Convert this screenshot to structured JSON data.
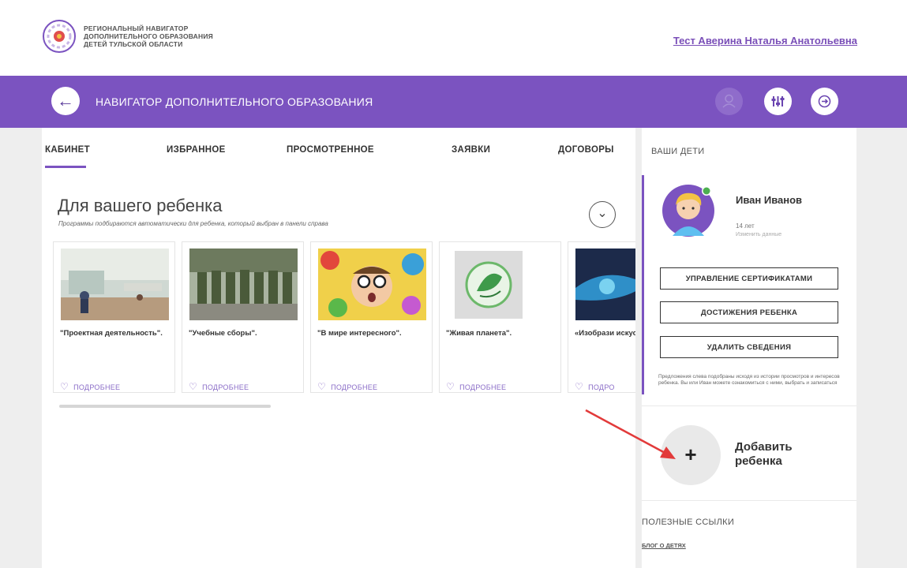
{
  "header": {
    "org_lines": [
      "РЕГИОНАЛЬНЫЙ НАВИГАТОР",
      "ДОПОЛНИТЕЛЬНОГО ОБРАЗОВАНИЯ",
      "ДЕТЕЙ ТУЛЬСКОЙ ОБЛАСТИ"
    ],
    "user_name": "Тест Аверина Наталья Анатольевна"
  },
  "topbar": {
    "back_icon": "←",
    "title": "НАВИГАТОР ДОПОЛНИТЕЛЬНОГО ОБРАЗОВАНИЯ",
    "person_icon": "ꕤ",
    "filter_icon": "⫶",
    "exit_icon": "⊖"
  },
  "tabs": [
    "КАБИНЕТ",
    "ИЗБРАННОЕ",
    "ПРОСМОТРЕННОЕ",
    "ЗАЯВКИ",
    "ДОГОВОРЫ"
  ],
  "section": {
    "title": "Для вашего ребенка",
    "subtitle": "Программы подбираются автоматически для ребенка, который выбран в панели справа",
    "chevron": "⌄"
  },
  "cards": [
    {
      "name": "\"Проектная деятельность\".",
      "more": "ПОДРОБНЕЕ"
    },
    {
      "name": "\"Учебные сборы\".",
      "more": "ПОДРОБНЕЕ"
    },
    {
      "name": "\"В мире интересного\".",
      "more": "ПОДРОБНЕЕ"
    },
    {
      "name": "\"Живая планета\".",
      "more": "ПОДРОБНЕЕ"
    },
    {
      "name": "«Изобрази искусство»",
      "more": "ПОДРО"
    }
  ],
  "sidebar": {
    "your_children": "ВАШИ ДЕТИ",
    "child": {
      "name": "Иван Иванов",
      "age": "14 лет",
      "edit": "Изменить данные"
    },
    "buttons": {
      "certificates": "УПРАВЛЕНИЕ СЕРТИФИКАТАМИ",
      "achievements": "ДОСТИЖЕНИЯ РЕБЕНКА",
      "delete": "УДАЛИТЬ СВЕДЕНИЯ"
    },
    "note": "Предложения слева подобраны исходя из истории просмотров и интересов ребенка. Вы или Иван можете ознакомиться с ними, выбрать и записаться",
    "add_child": {
      "plus": "+",
      "label": "Добавить ребенка"
    },
    "useful_links": "ПОЛЕЗНЫЕ ССЫЛКИ",
    "blog_link": "БЛОГ О ДЕТЯХ"
  },
  "colors": {
    "brand": "#7b53c0",
    "link": "#7a4fb8",
    "arrow": "#e23a3a"
  }
}
